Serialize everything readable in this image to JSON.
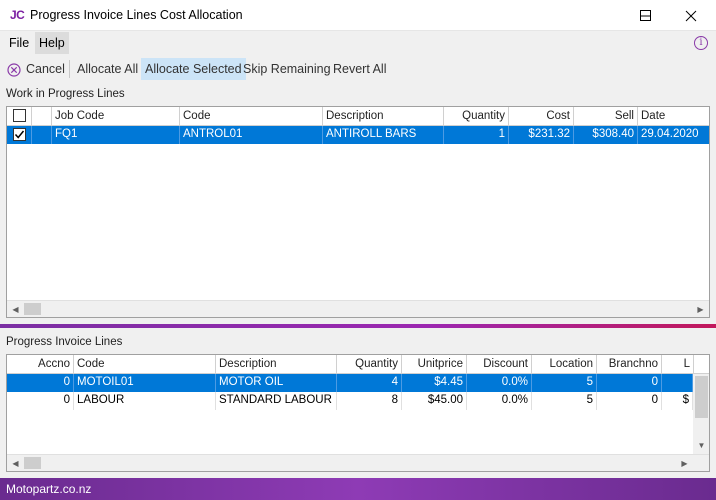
{
  "window": {
    "logo": "JC",
    "title": "Progress Invoice Lines Cost Allocation"
  },
  "menu": {
    "file": "File",
    "help": "Help"
  },
  "toolbar": {
    "cancel": "Cancel",
    "allocate_all": "Allocate All",
    "allocate_selected": "Allocate Selected",
    "skip_remaining": "Skip Remaining",
    "revert_all": "Revert All"
  },
  "wip": {
    "label": "Work in Progress Lines",
    "columns": {
      "job_code": "Job Code",
      "code": "Code",
      "description": "Description",
      "quantity": "Quantity",
      "cost": "Cost",
      "sell": "Sell",
      "date": "Date"
    },
    "rows": [
      {
        "checked": true,
        "job_code": "FQ1",
        "code": "ANTROL01",
        "description": "ANTIROLL BARS",
        "quantity": "1",
        "cost": "$231.32",
        "sell": "$308.40",
        "date": "29.04.2020"
      }
    ]
  },
  "pil": {
    "label": "Progress Invoice Lines",
    "columns": {
      "accno": "Accno",
      "code": "Code",
      "description": "Description",
      "quantity": "Quantity",
      "unitprice": "Unitprice",
      "discount": "Discount",
      "location": "Location",
      "branchno": "Branchno",
      "extra": "L"
    },
    "rows": [
      {
        "accno": "0",
        "code": "MOTOIL01",
        "description": "MOTOR OIL",
        "quantity": "4",
        "unitprice": "$4.45",
        "discount": "0.0%",
        "location": "5",
        "branchno": "0",
        "extra": ""
      },
      {
        "accno": "0",
        "code": "LABOUR",
        "description": "STANDARD LABOUR ...",
        "quantity": "8",
        "unitprice": "$45.00",
        "discount": "0.0%",
        "location": "5",
        "branchno": "0",
        "extra": "$"
      }
    ]
  },
  "status": {
    "text": "Motopartz.co.nz"
  },
  "icons": {
    "app": "jc-logo-icon",
    "minimize": "minimize-icon",
    "maximize": "maximize-icon",
    "close": "close-icon",
    "info": "info-icon",
    "cancel": "cancel-circle-icon"
  }
}
